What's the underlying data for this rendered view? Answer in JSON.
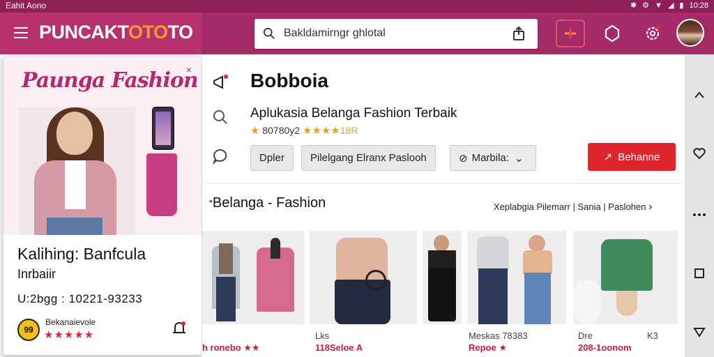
{
  "status": {
    "left_text": "Eahit Aono",
    "time": "10:28"
  },
  "brand": {
    "logo_main": "PUNCAKT",
    "logo_accent": "OTO",
    "logo_end": "TO"
  },
  "search": {
    "text": "Bakldamirngr ghlotal"
  },
  "ad": {
    "title": "Paunga Fashion",
    "close": "×",
    "headline": "Kalihing: Banfcula",
    "subline": "Inrbaiir",
    "phone": "U:2bgg : 10221-93233",
    "badge": "99",
    "seller": "Bekanaievole",
    "stars": "★★★★★"
  },
  "app": {
    "name": "Bobboia",
    "subtitle": "Aplukasia Belanga Fashion Terbaik",
    "rating_text": "80780y2",
    "rating_stars": "★★★★",
    "rating_tail": "18R",
    "chips": [
      "Dpler",
      "Pilelgang Elranx Paslooh",
      "Marbila:"
    ],
    "install_label": "Behanne"
  },
  "section": {
    "title": "Belanga - Fashion",
    "link": "Xeplabgia Pilemarr | Sania | Paslohen"
  },
  "products": [
    {
      "label1": "",
      "label2": "h ronebo ★★"
    },
    {
      "label1": "Lks",
      "label2": "118Seloe A"
    },
    {
      "label1": "",
      "label2": ""
    },
    {
      "label1": "Meskas 78383",
      "label2": "Repoe ★"
    },
    {
      "label1": "Dre",
      "label2": "208-1oonom",
      "label3": "K3"
    }
  ],
  "colors": {
    "appbar": "#a52b68",
    "brand_panel": "#b7316f",
    "accent_orange": "#f59a30",
    "install_red": "#e0262d",
    "star_gold": "#e6a21b",
    "ad_title": "#b3286f"
  }
}
